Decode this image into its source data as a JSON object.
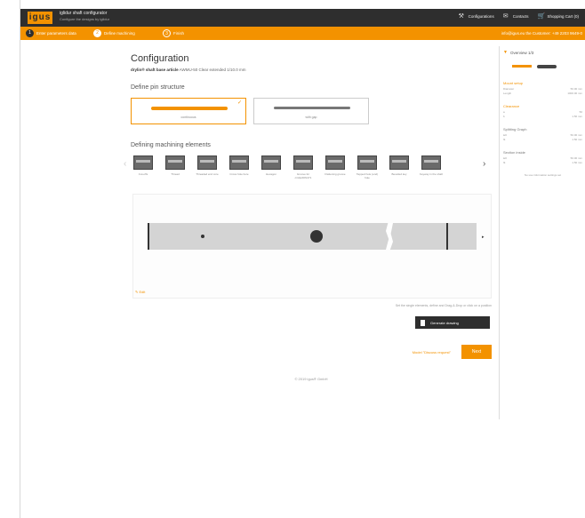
{
  "header": {
    "logo": "igus",
    "app_title": "iglidur shaft configurator",
    "app_subtitle": "Configure the designs by iglidur",
    "nav": [
      {
        "label": "Configurations",
        "icon": "wrench-icon"
      },
      {
        "label": "Contacts",
        "icon": "mail-icon"
      },
      {
        "label": "Shopping Cart (0)",
        "icon": "cart-icon"
      }
    ]
  },
  "steps": [
    {
      "num": "1",
      "label": "Enter parameters data"
    },
    {
      "num": "2",
      "label": "Define machining"
    },
    {
      "num": "3",
      "label": "Finish"
    }
  ],
  "orange_right": "info@igus.eu the Customer: +49 2203 9649-0",
  "main": {
    "title": "Configuration",
    "article_label": "drylin® shaft base article",
    "article_value": "AWMU-50 Clear extended 1/10.0 mm",
    "pin_section": "Define pin structure",
    "pins": [
      {
        "label": "continuous",
        "selected": true
      },
      {
        "label": "with gap",
        "selected": false
      }
    ],
    "machining_section": "Defining machining elements",
    "elements": [
      {
        "label": "Cut-offs"
      },
      {
        "label": "Thread"
      },
      {
        "label": "Threaded end core"
      },
      {
        "label": "Cross hole bore"
      },
      {
        "label": "Hexagon"
      },
      {
        "label": "Groove for circlip/DIN471"
      },
      {
        "label": "Flattening groove"
      },
      {
        "label": "Tapped hole (end) hole"
      },
      {
        "label": "Bevelled key"
      },
      {
        "label": "Keyway in the shaft"
      }
    ],
    "edit_link": "Edit",
    "hint": "Set the single elements, define and Drag-&-Drop or click on a position",
    "download_label": "Generate drawing",
    "discuss_label": "Model \"Discuss request\"",
    "next_label": "Next",
    "footer": "© 2019 igus® GmbH"
  },
  "sidebar": {
    "title": "Overview 1/3",
    "groups": [
      {
        "title": "Mount setup",
        "rows": [
          [
            "Diameter",
            "50.00 mm"
          ],
          [
            "Length",
            "1000.00 mm"
          ]
        ]
      },
      {
        "title": "Clearance",
        "rows": [
          [
            "a",
            "50"
          ],
          [
            "b",
            "1.50 mm"
          ]
        ]
      },
      {
        "title": "Splitting Graph",
        "rows": [
          [
            "left",
            "50.00 mm"
          ],
          [
            "fit",
            "1.50 mm"
          ]
        ]
      },
      {
        "title": "Section inside",
        "rows": [
          [
            "left",
            "50.00 mm"
          ],
          [
            "fit",
            "1.50 mm"
          ]
        ]
      }
    ],
    "note": "No use information settings set"
  },
  "colors": {
    "accent": "#f39200",
    "dark": "#2e2e2e"
  }
}
